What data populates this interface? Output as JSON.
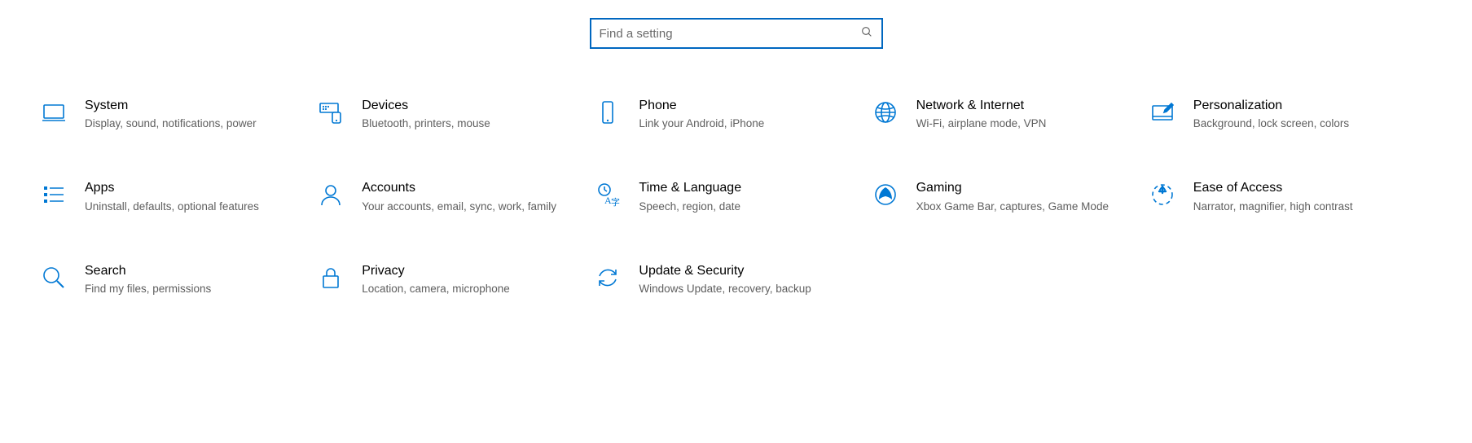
{
  "search": {
    "placeholder": "Find a setting"
  },
  "tiles": {
    "system": {
      "title": "System",
      "desc": "Display, sound, notifications, power"
    },
    "devices": {
      "title": "Devices",
      "desc": "Bluetooth, printers, mouse"
    },
    "phone": {
      "title": "Phone",
      "desc": "Link your Android, iPhone"
    },
    "network": {
      "title": "Network & Internet",
      "desc": "Wi-Fi, airplane mode, VPN"
    },
    "personalization": {
      "title": "Personalization",
      "desc": "Background, lock screen, colors"
    },
    "apps": {
      "title": "Apps",
      "desc": "Uninstall, defaults, optional features"
    },
    "accounts": {
      "title": "Accounts",
      "desc": "Your accounts, email, sync, work, family"
    },
    "time": {
      "title": "Time & Language",
      "desc": "Speech, region, date"
    },
    "gaming": {
      "title": "Gaming",
      "desc": "Xbox Game Bar, captures, Game Mode"
    },
    "ease": {
      "title": "Ease of Access",
      "desc": "Narrator, magnifier, high contrast"
    },
    "searchcat": {
      "title": "Search",
      "desc": "Find my files, permissions"
    },
    "privacy": {
      "title": "Privacy",
      "desc": "Location, camera, microphone"
    },
    "update": {
      "title": "Update & Security",
      "desc": "Windows Update, recovery, backup"
    }
  }
}
